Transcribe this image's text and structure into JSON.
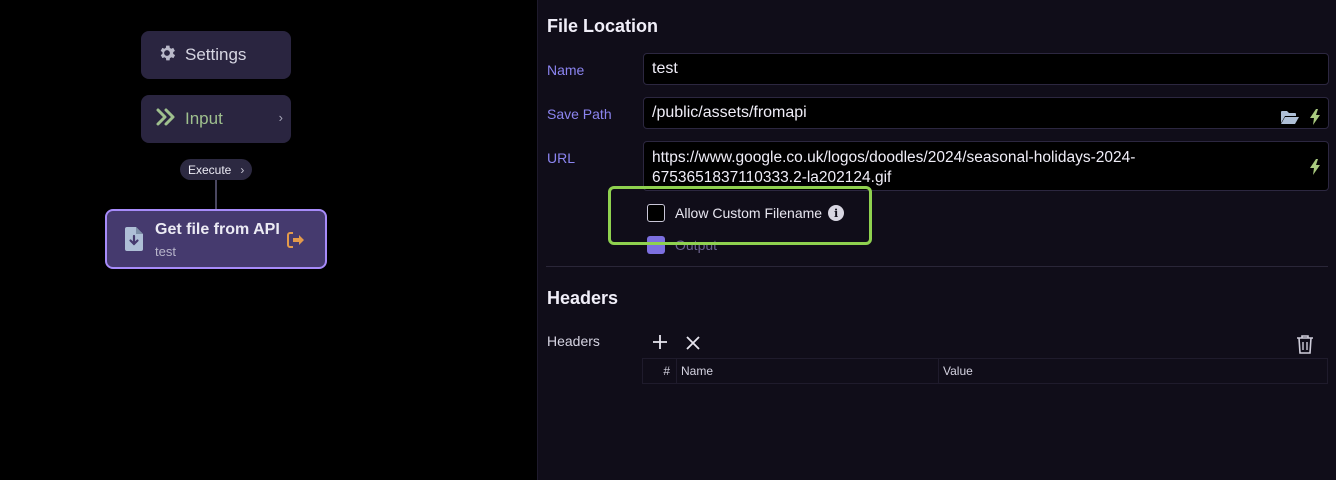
{
  "canvas": {
    "settings_node": {
      "label": "Settings",
      "icon": "gear-icon"
    },
    "input_node": {
      "label": "Input",
      "icon": "double-chevron-right-icon"
    },
    "execute_pill": {
      "label": "Execute"
    },
    "api_node": {
      "title": "Get file from API",
      "subtitle": "test",
      "icon": "file-download-icon",
      "exit_icon": "sign-out-icon"
    }
  },
  "panel": {
    "file_location": {
      "title": "File Location",
      "name": {
        "label": "Name",
        "value": "test"
      },
      "save_path": {
        "label": "Save Path",
        "value": "/public/assets/fromapi"
      },
      "url": {
        "label": "URL",
        "value_line1": "https://www.google.co.uk/logos/doodles/2024/seasonal-holidays-2024-",
        "value_line2": "6753651837110333.2-la202124.gif"
      },
      "allow_custom_filename": {
        "label": "Allow Custom Filename",
        "checked": false
      },
      "output": {
        "label": "Output",
        "checked": true
      }
    },
    "headers": {
      "title": "Headers",
      "label": "Headers",
      "columns": [
        "#",
        "Name",
        "Value"
      ]
    }
  },
  "colors": {
    "accent": "#a78bfa",
    "highlight": "#8fd14f",
    "label": "#8b84f0",
    "bolt": "#a8c97f"
  }
}
